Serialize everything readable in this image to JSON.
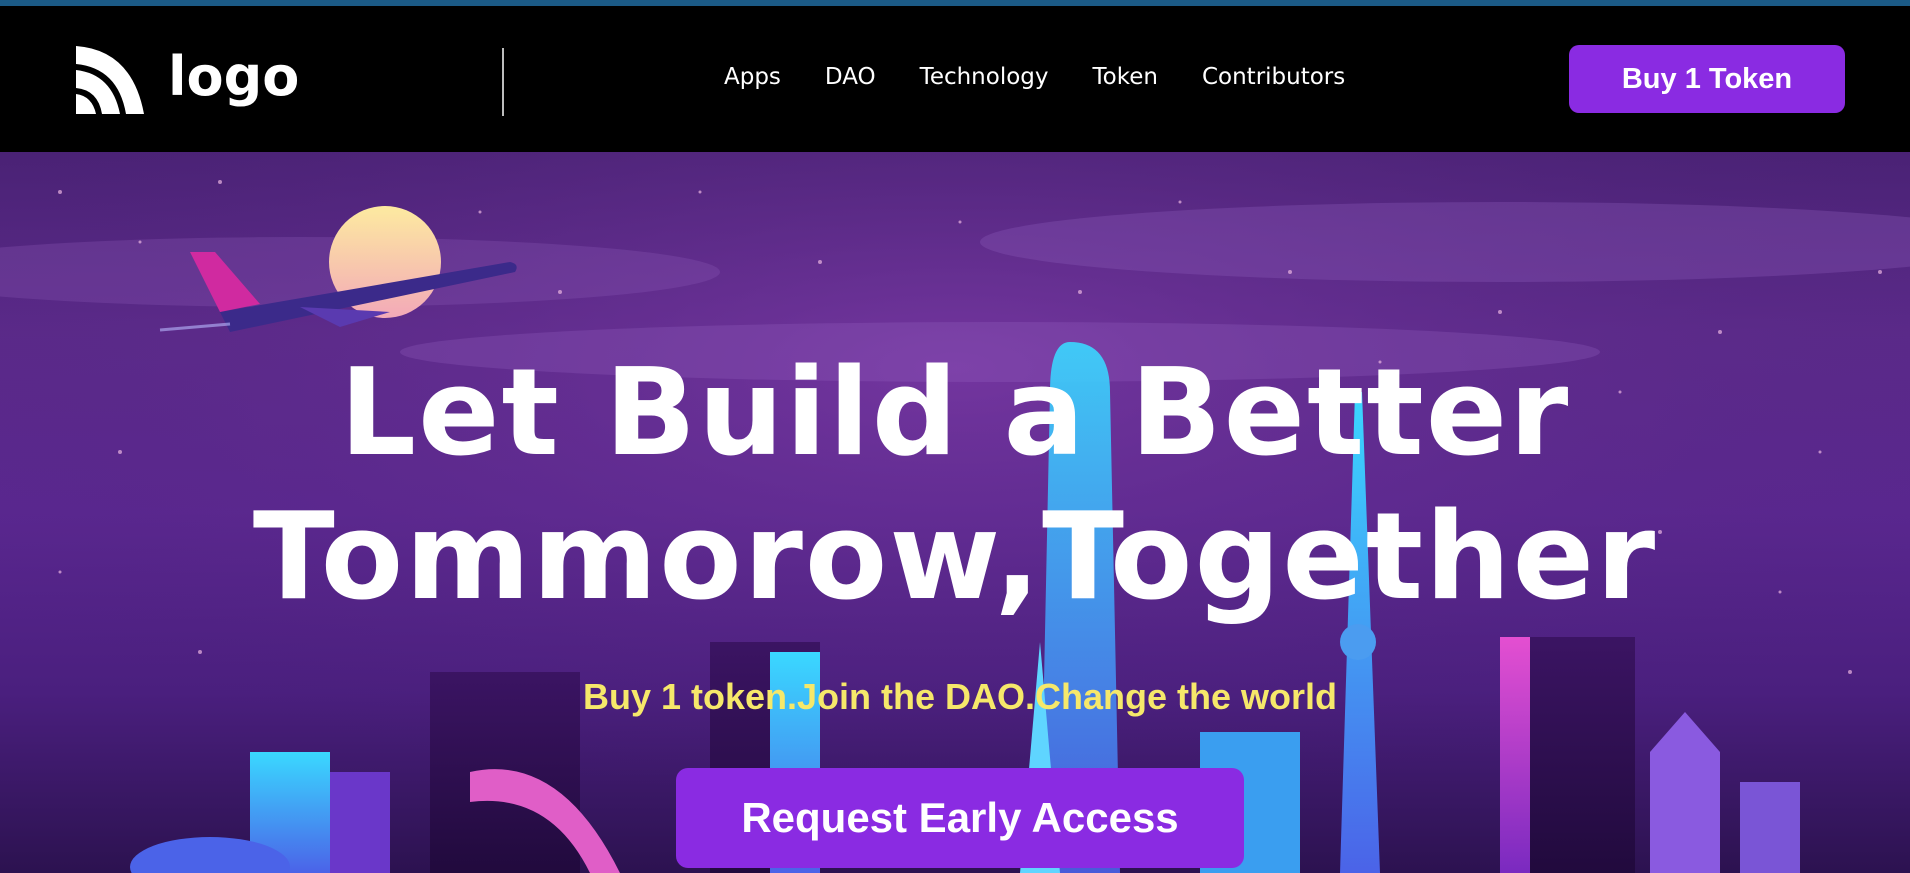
{
  "header": {
    "logo_text": "logo",
    "nav": [
      {
        "label": "Apps"
      },
      {
        "label": "DAO"
      },
      {
        "label": "Technology"
      },
      {
        "label": "Token"
      },
      {
        "label": "Contributors"
      }
    ],
    "buy_button_label": "Buy 1 Token"
  },
  "hero": {
    "title_line1": "Let Build a Better",
    "title_line2": "Tommorow,Together",
    "tagline": "Buy 1 token.Join the DAO.Change the world",
    "cta_label": "Request Early Access"
  },
  "colors": {
    "accent": "#8a2be2",
    "tagline": "#f6e86a",
    "header_bg": "#000000",
    "top_strip": "#1b5a86"
  },
  "icons": {
    "logo_mark": "wifi-arcs-logo-icon"
  }
}
